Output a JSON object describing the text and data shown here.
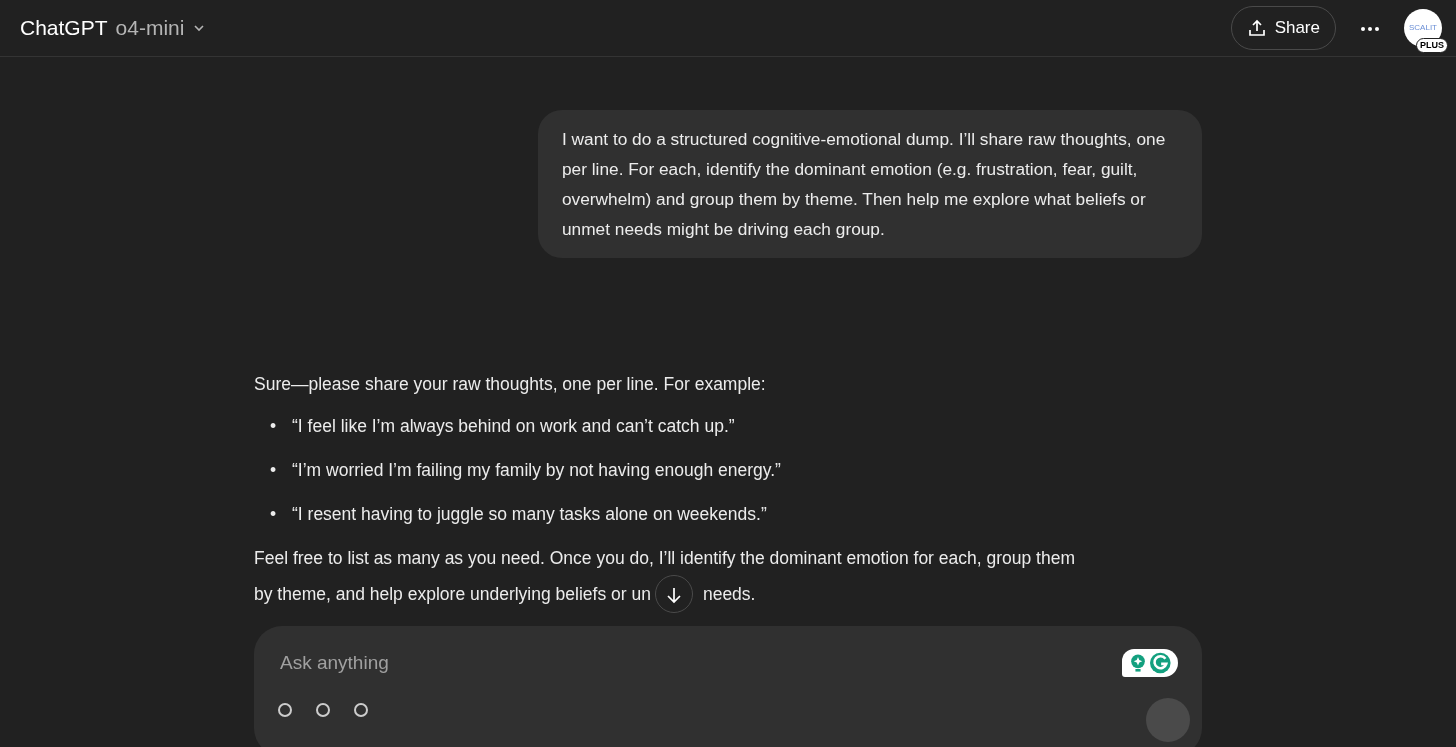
{
  "header": {
    "title": "ChatGPT",
    "model": "o4-mini",
    "share_label": "Share",
    "avatar_text": "SCALIT",
    "plan_badge": "PLUS"
  },
  "user_message": "I want to do a structured cognitive-emotional dump. I’ll share raw thoughts, one per line. For each, identify the dominant emotion (e.g. frustration, fear, guilt, overwhelm) and group them by theme. Then help me explore what beliefs or unmet needs might be driving each group.",
  "reply": {
    "intro": "Sure—please share your raw thoughts, one per line. For example:",
    "bullets": [
      {
        "marker": "•",
        "text": "“I feel like I’m always behind on work and can’t catch up.”"
      },
      {
        "marker": "•",
        "text": "“I’m worried I’m failing my family by not having enough energy.”"
      },
      {
        "marker": "•",
        "text": "“I resent having to juggle so many tasks alone on weekends.”"
      }
    ],
    "closing_line_1": "Feel free to list as many as you need. Once you do, I’ll identify the dominant emotion for each, group them",
    "closing_line_2_before": "by theme, and help explore underlying beliefs or un",
    "closing_line_2_after": "needs."
  },
  "composer": {
    "placeholder": "Ask anything"
  }
}
